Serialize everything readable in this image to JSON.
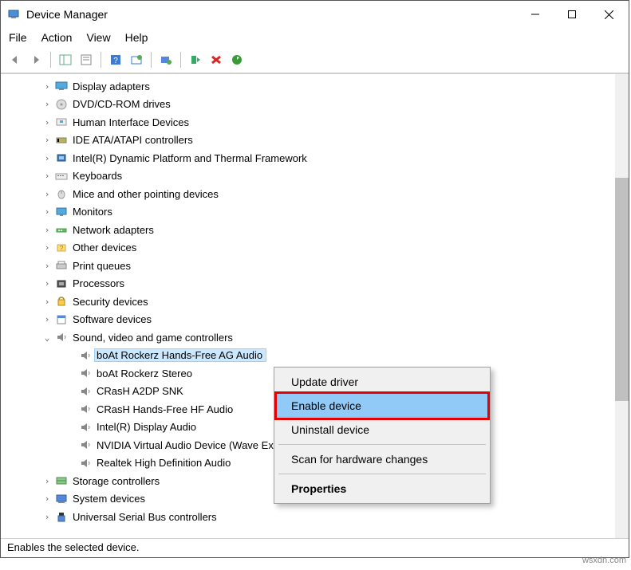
{
  "window": {
    "title": "Device Manager"
  },
  "menu": {
    "file": "File",
    "action": "Action",
    "view": "View",
    "help": "Help"
  },
  "tree": {
    "items": [
      {
        "label": "Display adapters",
        "icon": "display",
        "exp": ">"
      },
      {
        "label": "DVD/CD-ROM drives",
        "icon": "disc",
        "exp": ">"
      },
      {
        "label": "Human Interface Devices",
        "icon": "hid",
        "exp": ">"
      },
      {
        "label": "IDE ATA/ATAPI controllers",
        "icon": "ide",
        "exp": ">"
      },
      {
        "label": "Intel(R) Dynamic Platform and Thermal Framework",
        "icon": "chip",
        "exp": ">"
      },
      {
        "label": "Keyboards",
        "icon": "keyboard",
        "exp": ">"
      },
      {
        "label": "Mice and other pointing devices",
        "icon": "mouse",
        "exp": ">"
      },
      {
        "label": "Monitors",
        "icon": "monitor",
        "exp": ">"
      },
      {
        "label": "Network adapters",
        "icon": "network",
        "exp": ">"
      },
      {
        "label": "Other devices",
        "icon": "other",
        "exp": ">"
      },
      {
        "label": "Print queues",
        "icon": "printer",
        "exp": ">"
      },
      {
        "label": "Processors",
        "icon": "cpu",
        "exp": ">"
      },
      {
        "label": "Security devices",
        "icon": "security",
        "exp": ">"
      },
      {
        "label": "Software devices",
        "icon": "software",
        "exp": ">"
      },
      {
        "label": "Sound, video and game controllers",
        "icon": "sound",
        "exp": "v",
        "children": [
          {
            "label": "boAt Rockerz Hands-Free AG Audio",
            "selected": true
          },
          {
            "label": "boAt Rockerz Stereo"
          },
          {
            "label": "CRasH A2DP SNK"
          },
          {
            "label": "CRasH Hands-Free HF Audio"
          },
          {
            "label": "Intel(R) Display Audio"
          },
          {
            "label": "NVIDIA Virtual Audio Device (Wave Extensible) (WDM)"
          },
          {
            "label": "Realtek High Definition Audio"
          }
        ]
      },
      {
        "label": "Storage controllers",
        "icon": "storage",
        "exp": ">"
      },
      {
        "label": "System devices",
        "icon": "system",
        "exp": ">"
      },
      {
        "label": "Universal Serial Bus controllers",
        "icon": "usb",
        "exp": ">"
      }
    ]
  },
  "context": {
    "update": "Update driver",
    "enable": "Enable device",
    "uninstall": "Uninstall device",
    "scan": "Scan for hardware changes",
    "properties": "Properties"
  },
  "status": "Enables the selected device.",
  "watermark": "wsxdn.com"
}
